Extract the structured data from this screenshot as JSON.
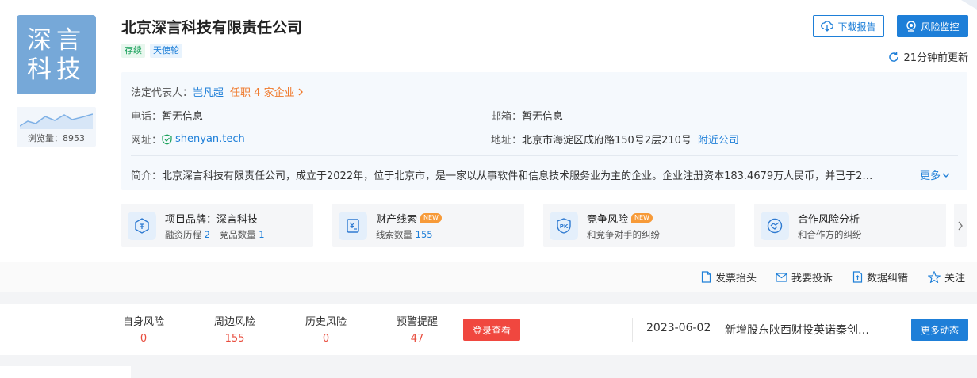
{
  "company": {
    "logo_line1": "深言",
    "logo_line2": "科技",
    "name": "北京深言科技有限责任公司",
    "tags": [
      "存续",
      "天使轮"
    ],
    "views_label": "浏览量：8953"
  },
  "header_actions": {
    "download_label": "下载报告",
    "monitor_label": "风险监控",
    "update_text": "21分钟前更新"
  },
  "info": {
    "legal_rep_label": "法定代表人：",
    "legal_rep_name": "岂凡超",
    "legal_rep_roles": "任职 4 家企业",
    "phone_label": "电话：",
    "phone_value": "暂无信息",
    "email_label": "邮箱：",
    "email_value": "暂无信息",
    "website_label": "网址：",
    "website_value": "shenyan.tech",
    "address_label": "地址：",
    "address_value": "北京市海淀区成府路150号2层210号",
    "nearby_label": "附近公司",
    "intro_label": "简介：",
    "intro_value": "北京深言科技有限责任公司，成立于2022年，位于北京市，是一家以从事软件和信息技术服务业为主的企业。企业注册资本183.4679万人民币，并已于2…",
    "more_label": "更多"
  },
  "features": [
    {
      "title": "项目品牌：深言科技",
      "sub_a_label": "融资历程",
      "sub_a_value": "2",
      "sub_b_label": "竞品数量",
      "sub_b_value": "1"
    },
    {
      "title": "财产线索",
      "badge": "NEW",
      "sub_a_label": "线索数量",
      "sub_a_value": "155"
    },
    {
      "title": "竞争风险",
      "badge": "NEW",
      "sub": "和竞争对手的纠纷"
    },
    {
      "title": "合作风险分析",
      "sub": "和合作方的纠纷"
    }
  ],
  "action_bar": {
    "invoice": "发票抬头",
    "complain": "我要投诉",
    "correct": "数据纠错",
    "follow": "关注"
  },
  "risks": [
    {
      "label": "自身风险",
      "value": "0"
    },
    {
      "label": "周边风险",
      "value": "155"
    },
    {
      "label": "历史风险",
      "value": "0"
    },
    {
      "label": "预警提醒",
      "value": "47"
    }
  ],
  "login_button": "登录查看",
  "news": {
    "date": "2023-06-02",
    "text": "新增股东陕西财投英诺秦创…",
    "more_button": "更多动态"
  },
  "colors": {
    "primary": "#1e7fd8",
    "danger": "#f0473f",
    "accent": "#f0792b"
  }
}
